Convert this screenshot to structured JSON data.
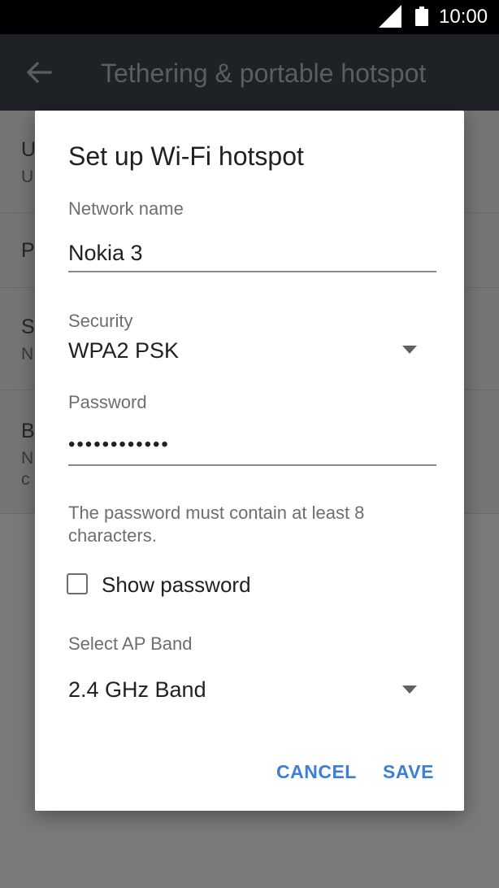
{
  "status_bar": {
    "time": "10:00",
    "signal_icon": "cell-signal-icon",
    "battery_icon": "battery-icon"
  },
  "app_bar": {
    "title": "Tethering & portable hotspot",
    "back_icon": "back-arrow-icon"
  },
  "background_list": [
    {
      "title": "U",
      "subtitle": "U"
    },
    {
      "title": "P",
      "subtitle": ""
    },
    {
      "title": "S",
      "subtitle": "N"
    },
    {
      "title": "B",
      "subtitle": "N",
      "subtitle2": "c"
    }
  ],
  "dialog": {
    "title": "Set up Wi-Fi hotspot",
    "network_name_label": "Network name",
    "network_name_value": "Nokia 3",
    "security_label": "Security",
    "security_value": "WPA2 PSK",
    "password_label": "Password",
    "password_value": "••••••••••••",
    "password_hint": "The password must contain at least 8 characters.",
    "show_password_label": "Show password",
    "show_password_checked": false,
    "ap_band_label": "Select AP Band",
    "ap_band_value": "2.4 GHz Band",
    "cancel_label": "CANCEL",
    "save_label": "SAVE"
  },
  "colors": {
    "accent": "#3d7fd6",
    "status_bar": "#000000",
    "app_bar_dimmed": "#1e2226",
    "scrim": "#7a7a7a"
  }
}
